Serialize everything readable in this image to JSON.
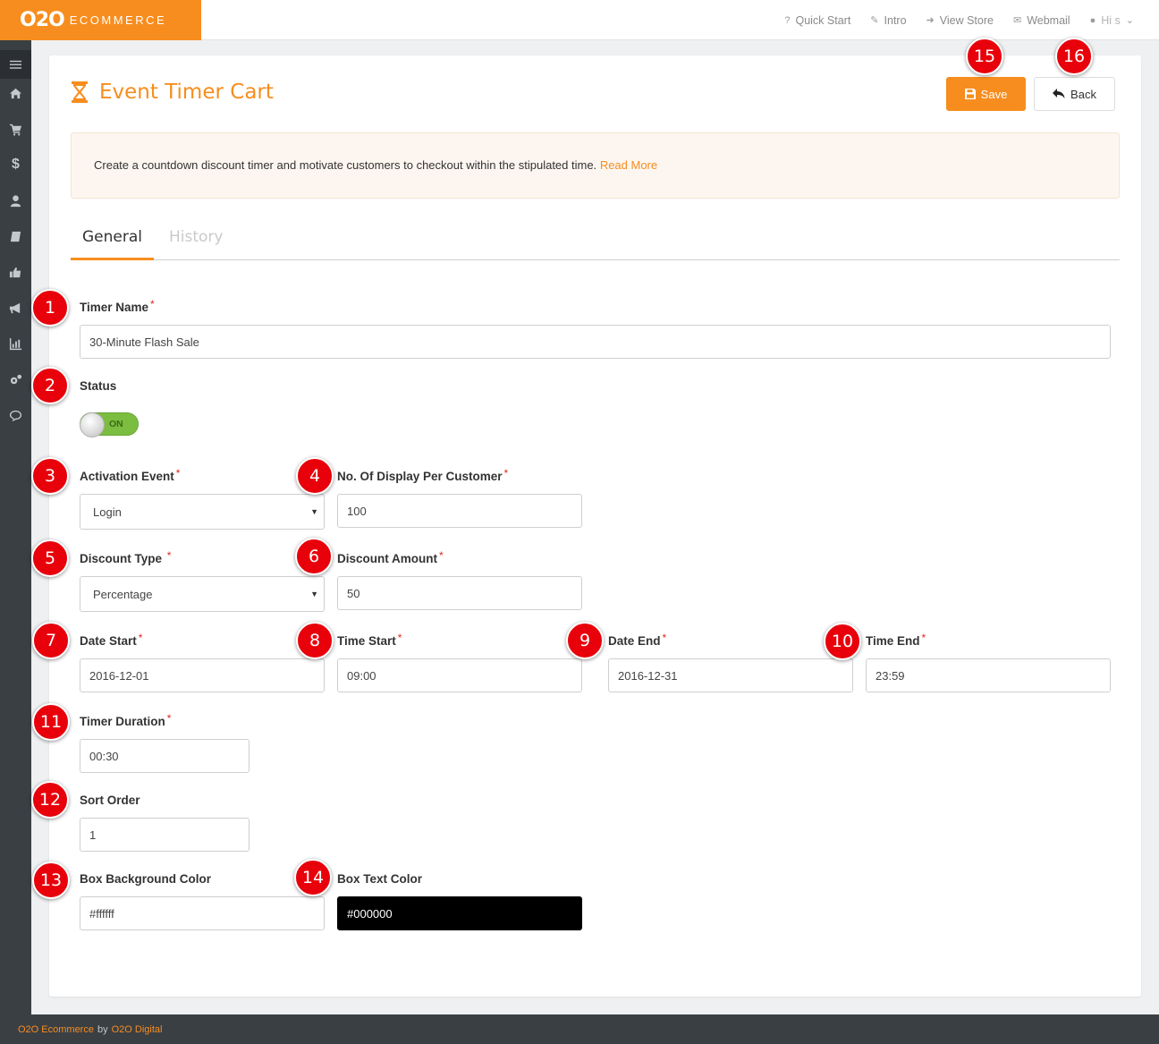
{
  "brand": {
    "mark": "O2O",
    "word": "ECOMMERCE"
  },
  "topnav": {
    "quick_start": "Quick Start",
    "intro": "Intro",
    "view_store": "View Store",
    "webmail": "Webmail",
    "user": "Hi s"
  },
  "sidebar": {
    "items": [
      "menu-icon",
      "home-icon",
      "cart-icon",
      "dollar-icon",
      "user-icon",
      "book-icon",
      "thumbs-up-icon",
      "megaphone-icon",
      "chart-icon",
      "cogs-icon",
      "comment-icon"
    ]
  },
  "page": {
    "title": "Event Timer Cart"
  },
  "actions": {
    "save": "Save",
    "back": "Back"
  },
  "info": {
    "text": "Create a countdown discount timer and motivate customers to checkout within the stipulated time.",
    "link": "Read More"
  },
  "tabs": {
    "general": "General",
    "history": "History"
  },
  "form": {
    "timer_name": {
      "label": "Timer Name",
      "value": "30-Minute Flash Sale"
    },
    "status": {
      "label": "Status",
      "toggle": "ON"
    },
    "activation_event": {
      "label": "Activation Event",
      "value": "Login"
    },
    "display_per_customer": {
      "label": "No. Of Display Per Customer",
      "value": "100"
    },
    "discount_type": {
      "label": "Discount Type",
      "value": "Percentage"
    },
    "discount_amount": {
      "label": "Discount Amount",
      "value": "50"
    },
    "date_start": {
      "label": "Date Start",
      "value": "2016-12-01"
    },
    "time_start": {
      "label": "Time Start",
      "value": "09:00"
    },
    "date_end": {
      "label": "Date End",
      "value": "2016-12-31"
    },
    "time_end": {
      "label": "Time End",
      "value": "23:59"
    },
    "timer_duration": {
      "label": "Timer Duration",
      "value": "00:30"
    },
    "sort_order": {
      "label": "Sort Order",
      "value": "1"
    },
    "box_bg_color": {
      "label": "Box Background Color",
      "value": "#ffffff"
    },
    "box_text_color": {
      "label": "Box Text Color",
      "value": "#000000"
    },
    "required_mark": "*"
  },
  "badges": [
    "1",
    "2",
    "3",
    "4",
    "5",
    "6",
    "7",
    "8",
    "9",
    "10",
    "11",
    "12",
    "13",
    "14",
    "15",
    "16"
  ],
  "footer": {
    "brand": "O2O Ecommerce",
    "by": "by",
    "company": "O2O Digital"
  },
  "colors": {
    "accent": "#f78d1e",
    "badge": "#e8000b",
    "sidebar": "#3a3f44",
    "toggle_on": "#7bbd41"
  }
}
